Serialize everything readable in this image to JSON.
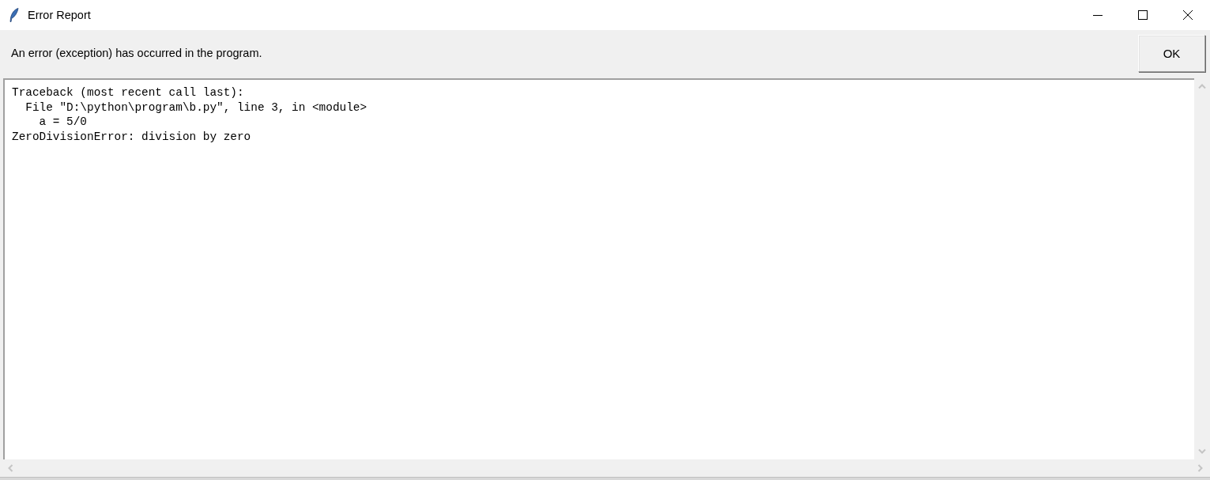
{
  "window": {
    "title": "Error Report"
  },
  "message": "An error (exception) has occurred in the program.",
  "buttons": [
    "OK"
  ],
  "output": {
    "lines": [
      "Traceback (most recent call last):",
      "  File \"D:\\python\\program\\b.py\", line 3, in <module>",
      "    a = 5/0",
      "ZeroDivisionError: division by zero"
    ]
  }
}
